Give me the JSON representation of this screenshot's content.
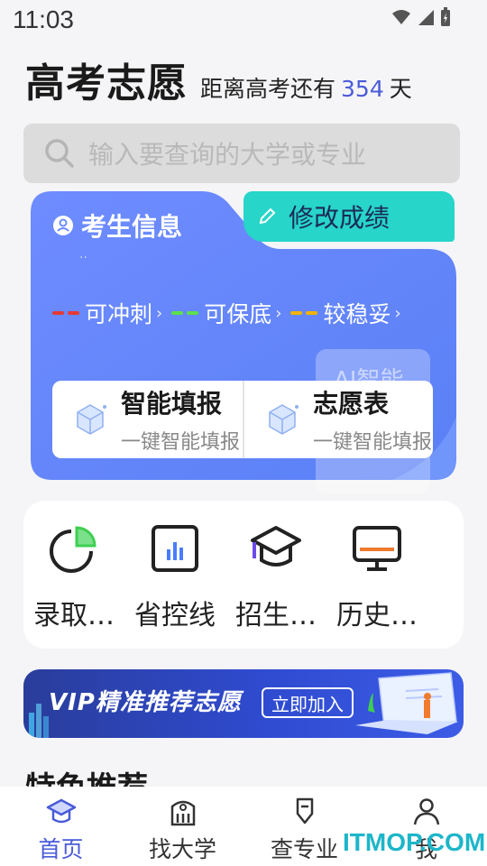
{
  "status_bar": {
    "time": "11:03"
  },
  "header": {
    "title": "高考志愿",
    "countdown_prefix": "距离高考还有",
    "days": "354",
    "countdown_suffix": "天"
  },
  "search": {
    "placeholder": "输入要查询的大学或专业"
  },
  "info_card": {
    "title": "考生信息",
    "edit_button": "修改成绩",
    "dots": "..",
    "legend": [
      {
        "label": "可冲刺",
        "color": "#e53935"
      },
      {
        "label": "可保底",
        "color": "#5be04a"
      },
      {
        "label": "较稳妥",
        "color": "#f4b400"
      }
    ],
    "ghost_text": "AI智能",
    "actions": [
      {
        "title": "智能填报",
        "subtitle": "一键智能填报"
      },
      {
        "title": "志愿表",
        "subtitle": "一键智能填报"
      }
    ]
  },
  "quick_links": [
    {
      "label": "录取…",
      "icon": "pie-chart-icon"
    },
    {
      "label": "省控线",
      "icon": "bar-chart-icon"
    },
    {
      "label": "招生…",
      "icon": "graduation-cap-icon"
    },
    {
      "label": "历史…",
      "icon": "monitor-icon"
    }
  ],
  "vip_banner": {
    "text": "VIP精准推荐志愿",
    "join": "立即加入"
  },
  "section": {
    "title": "特色推荐"
  },
  "bottom_nav": [
    {
      "label": "首页",
      "icon": "home-cap-icon",
      "active": true
    },
    {
      "label": "找大学",
      "icon": "university-icon",
      "active": false
    },
    {
      "label": "查专业",
      "icon": "major-icon",
      "active": false
    },
    {
      "label": "我",
      "icon": "profile-icon",
      "active": false
    }
  ],
  "watermark": "ITMOP.COM",
  "colors": {
    "accent": "#4a5bd8",
    "teal": "#27d5c9",
    "card_blue": "#6b8cff"
  }
}
